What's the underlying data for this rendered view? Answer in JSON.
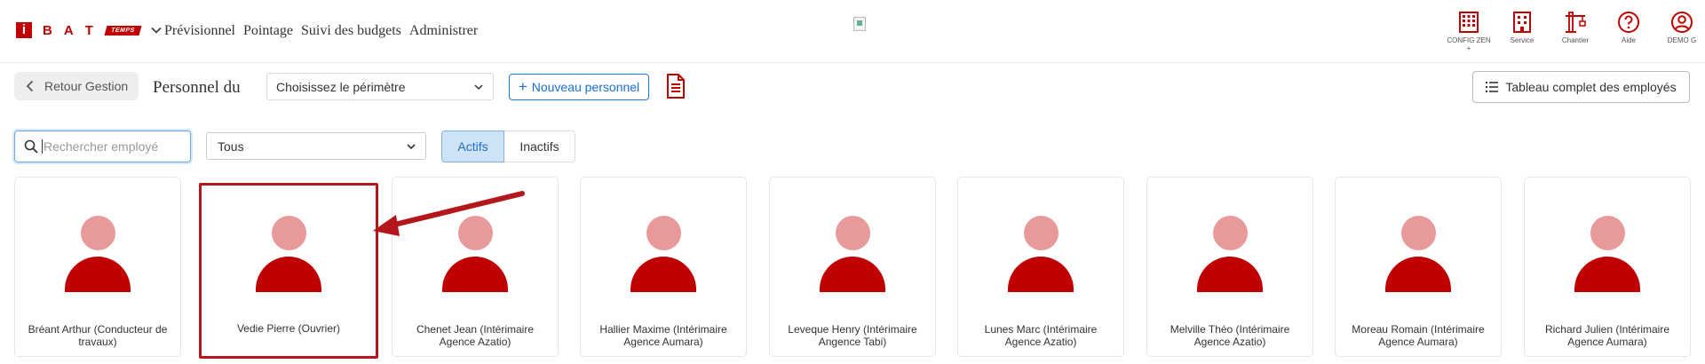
{
  "nav": {
    "logo_i": "i",
    "logo_letters": [
      "B",
      "A",
      "T"
    ],
    "logo_badge": "TEMPS",
    "items": [
      "Prévisionnel",
      "Pointage",
      "Suivi des budgets",
      "Administrer"
    ],
    "right": [
      {
        "label": "CONFIG ZEN",
        "sub": "+",
        "icon": "building-grid-icon"
      },
      {
        "label": "Service",
        "icon": "office-building-icon"
      },
      {
        "label": "Chantier",
        "icon": "crane-icon"
      },
      {
        "label": "Aide",
        "icon": "help-circle-icon"
      },
      {
        "label": "DEMO G",
        "icon": "user-circle-icon"
      }
    ]
  },
  "subbar": {
    "back_label": "Retour Gestion",
    "title": "Personnel du",
    "perimetre_placeholder": "Choisissez le périmètre",
    "new_label": "Nouveau personnel",
    "full_table_label": "Tableau complet des employés"
  },
  "filters": {
    "search_placeholder": "Rechercher employé",
    "type_value": "Tous",
    "active_label": "Actifs",
    "inactive_label": "Inactifs"
  },
  "employees": [
    {
      "line1": "Bréant Arthur (Conducteur de",
      "line2": "travaux)"
    },
    {
      "line1": "Vedie Pierre (Ouvrier)",
      "line2": ""
    },
    {
      "line1": "Chenet Jean (Intérimaire",
      "line2": "Agence Azatio)"
    },
    {
      "line1": "Hallier Maxime (Intérimaire",
      "line2": "Agence Aumara)"
    },
    {
      "line1": "Leveque Henry (Intérimaire",
      "line2": "Angence Tabi)"
    },
    {
      "line1": "Lunes Marc (Intérimaire",
      "line2": "Agence Azatio)"
    },
    {
      "line1": "Melville Théo (Intérimaire",
      "line2": "Agence Azatio)"
    },
    {
      "line1": "Moreau Romain (Intérimaire",
      "line2": "Agence Aumara)"
    },
    {
      "line1": "Richard Julien (Intérimaire",
      "line2": "Agence Aumara)"
    }
  ],
  "colors": {
    "brand": "#c00000",
    "accent": "#1a6fd0"
  }
}
